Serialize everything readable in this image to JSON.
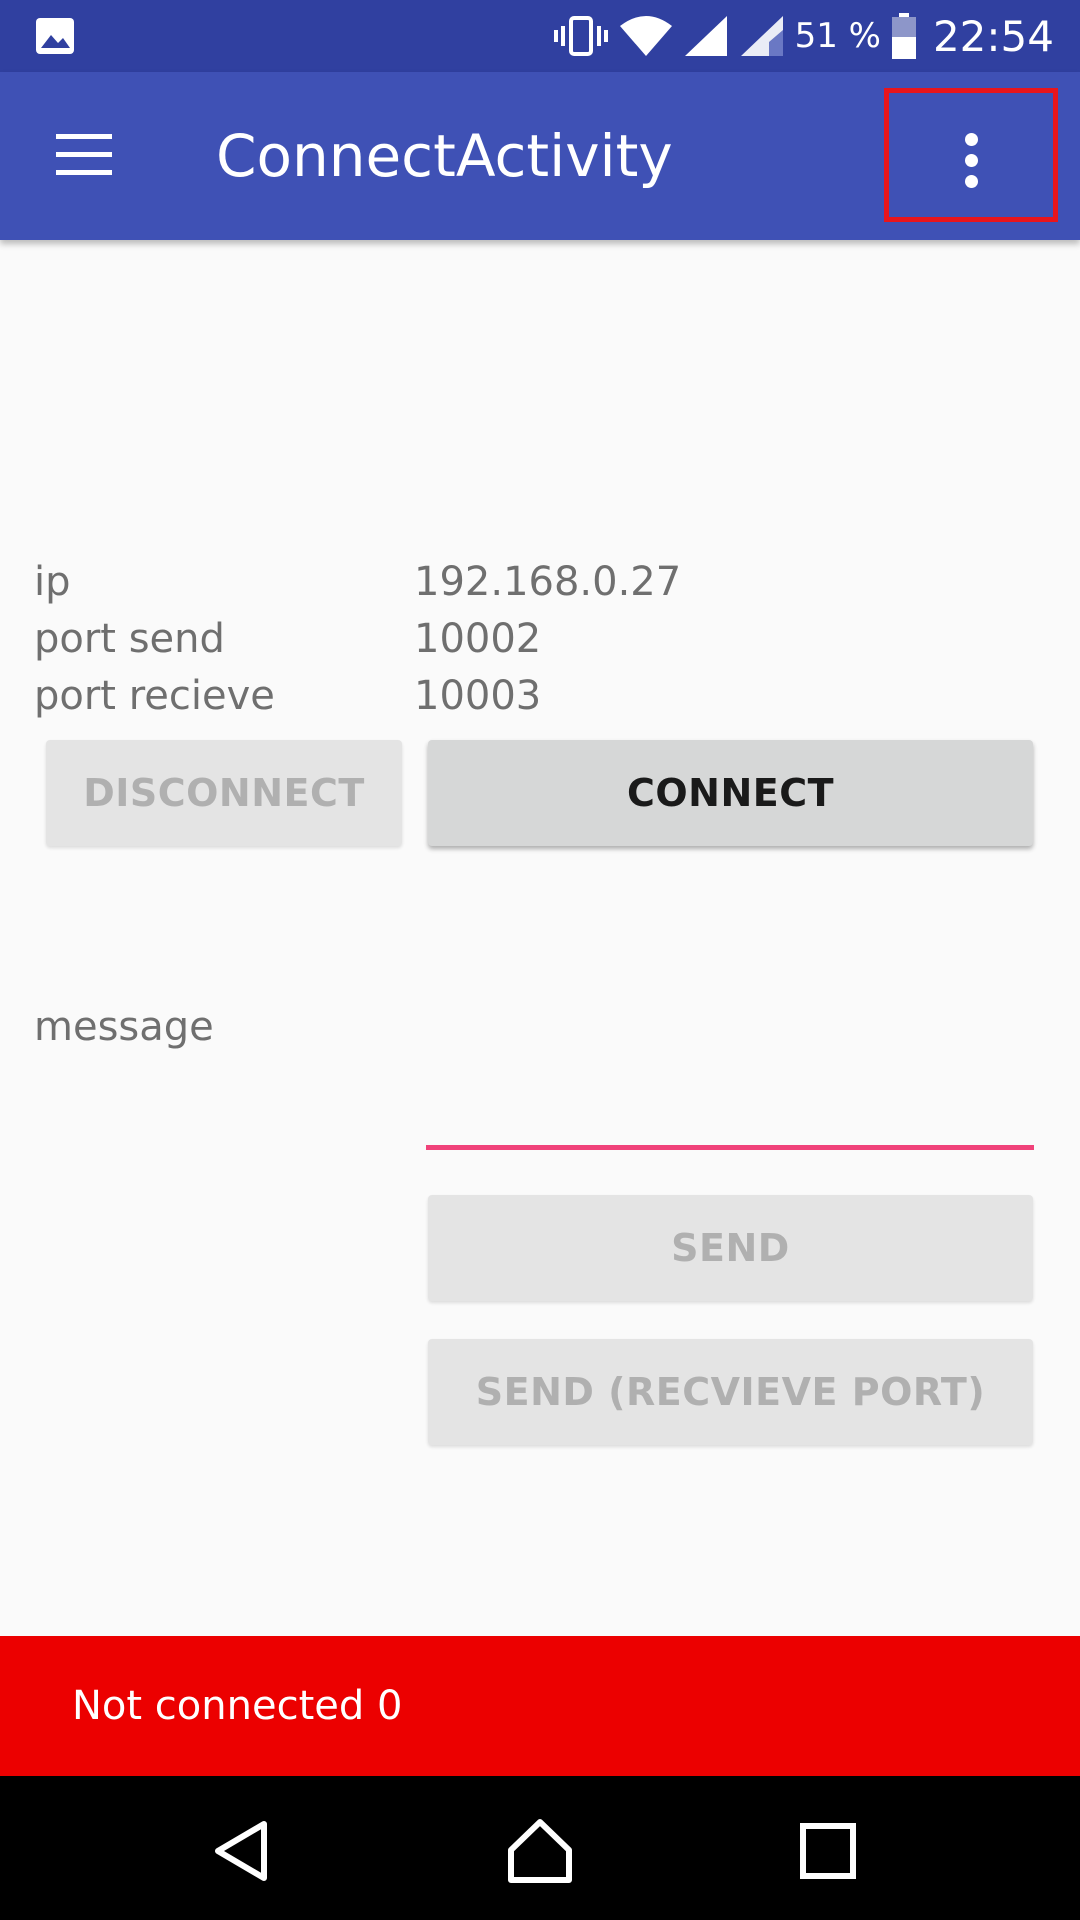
{
  "status_bar": {
    "battery_percent": "51 %",
    "time": "22:54",
    "icons": [
      "gallery-icon",
      "vibrate-icon",
      "wifi-icon",
      "signal-icon",
      "signal-icon-2",
      "battery-icon"
    ]
  },
  "app_bar": {
    "title": "ConnectActivity",
    "menu_icon": "hamburger-menu-icon",
    "overflow_icon": "more-vertical-icon"
  },
  "connection": {
    "ip_label": "ip",
    "ip_value": "192.168.0.27",
    "port_send_label": "port send",
    "port_send_value": "10002",
    "port_receive_label": "port recieve",
    "port_receive_value": "10003"
  },
  "buttons": {
    "disconnect": "DISCONNECT",
    "connect": "CONNECT",
    "send": "SEND",
    "send_receive_port": "SEND (RECVIEVE PORT)"
  },
  "message": {
    "label": "message",
    "value": ""
  },
  "snackbar": {
    "text": "Not connected 0"
  },
  "nav_bar": {
    "icons": [
      "back-icon",
      "home-icon",
      "recents-icon"
    ]
  },
  "colors": {
    "status_bar": "#3040a0",
    "app_bar": "#3f51b5",
    "accent": "#f0427a",
    "snackbar": "#ec0000"
  }
}
